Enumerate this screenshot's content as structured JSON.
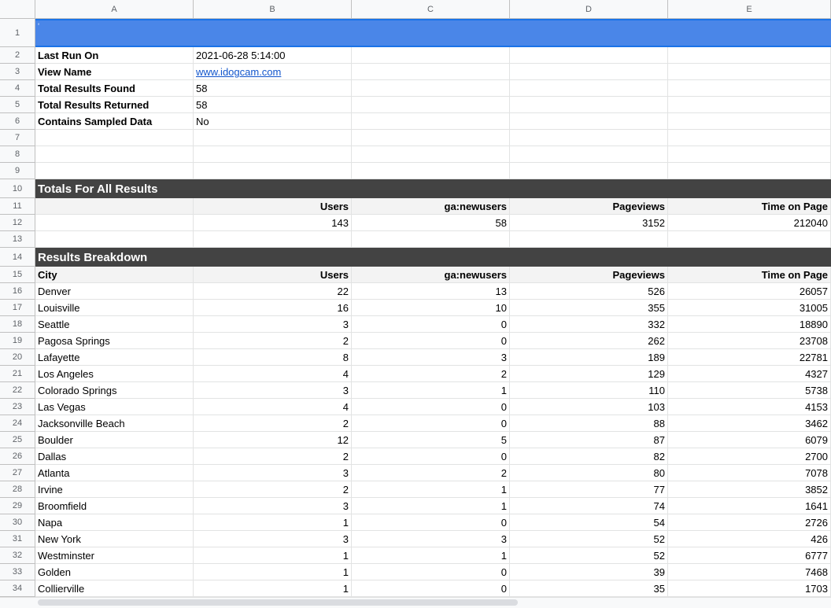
{
  "columns": [
    "A",
    "B",
    "C",
    "D",
    "E"
  ],
  "row1_text": "'",
  "meta": [
    {
      "label": "Last Run On",
      "value": "2021-06-28 5:14:00",
      "link": false
    },
    {
      "label": "View Name",
      "value": "www.idogcam.com",
      "link": true
    },
    {
      "label": "Total Results Found",
      "value": "58",
      "link": false
    },
    {
      "label": "Total Results Returned",
      "value": "58",
      "link": false
    },
    {
      "label": "Contains Sampled Data",
      "value": "No",
      "link": false
    }
  ],
  "totals": {
    "title": "Totals For All Results",
    "headers": [
      "",
      "Users",
      "ga:newusers",
      "Pageviews",
      "Time on Page"
    ],
    "values": [
      "",
      "143",
      "58",
      "3152",
      "212040"
    ]
  },
  "breakdown": {
    "title": "Results Breakdown",
    "headers": [
      "City",
      "Users",
      "ga:newusers",
      "Pageviews",
      "Time on Page"
    ],
    "rows": [
      [
        "Denver",
        "22",
        "13",
        "526",
        "26057"
      ],
      [
        "Louisville",
        "16",
        "10",
        "355",
        "31005"
      ],
      [
        "Seattle",
        "3",
        "0",
        "332",
        "18890"
      ],
      [
        "Pagosa Springs",
        "2",
        "0",
        "262",
        "23708"
      ],
      [
        "Lafayette",
        "8",
        "3",
        "189",
        "22781"
      ],
      [
        "Los Angeles",
        "4",
        "2",
        "129",
        "4327"
      ],
      [
        "Colorado Springs",
        "3",
        "1",
        "110",
        "5738"
      ],
      [
        "Las Vegas",
        "4",
        "0",
        "103",
        "4153"
      ],
      [
        "Jacksonville Beach",
        "2",
        "0",
        "88",
        "3462"
      ],
      [
        "Boulder",
        "12",
        "5",
        "87",
        "6079"
      ],
      [
        "Dallas",
        "2",
        "0",
        "82",
        "2700"
      ],
      [
        "Atlanta",
        "3",
        "2",
        "80",
        "7078"
      ],
      [
        "Irvine",
        "2",
        "1",
        "77",
        "3852"
      ],
      [
        "Broomfield",
        "3",
        "1",
        "74",
        "1641"
      ],
      [
        "Napa",
        "1",
        "0",
        "54",
        "2726"
      ],
      [
        "New York",
        "3",
        "3",
        "52",
        "426"
      ],
      [
        "Westminster",
        "1",
        "1",
        "52",
        "6777"
      ],
      [
        "Golden",
        "1",
        "0",
        "39",
        "7468"
      ],
      [
        "Collierville",
        "1",
        "0",
        "35",
        "1703"
      ]
    ]
  }
}
